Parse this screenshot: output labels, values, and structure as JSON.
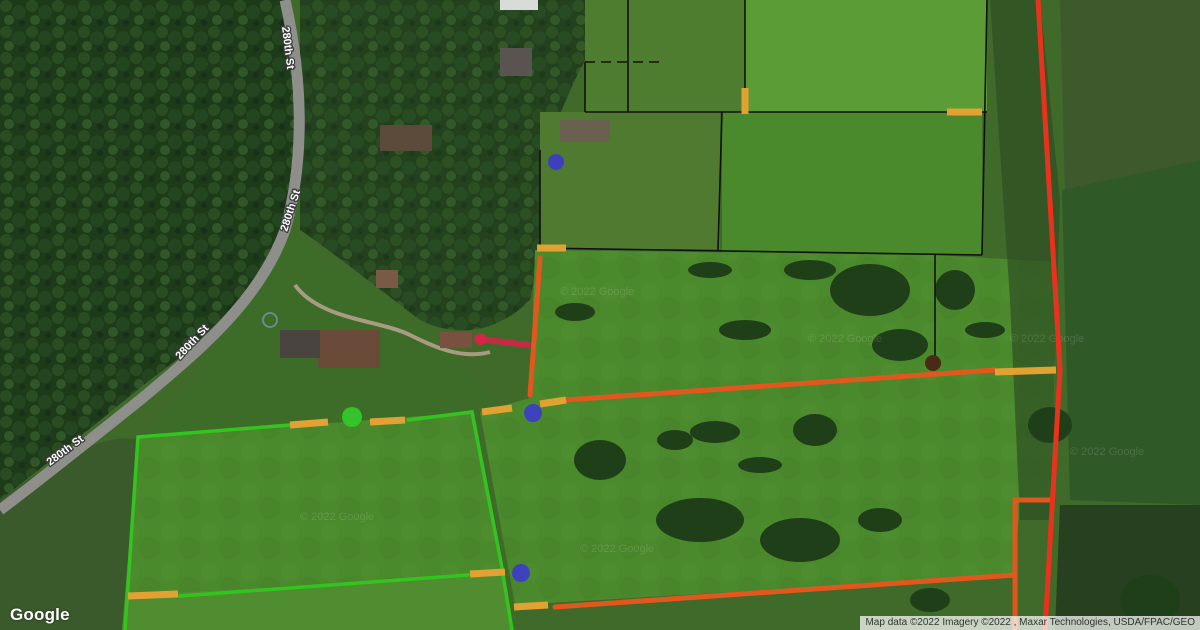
{
  "map": {
    "road_labels": [
      "280th St",
      "280th St",
      "280th St",
      "280th St"
    ],
    "watermark": "© 2022 Google",
    "logo": "Google",
    "attribution": "Map data ©2022 Imagery ©2022 , Maxar Technologies, USDA/FPAC/GEO"
  },
  "colors": {
    "fence_red": "#e8321e",
    "fence_orange": "#e2571e",
    "fence_green": "#33c420",
    "gate_tan": "#e2a233",
    "property_line": "#111111",
    "marker_blue": "#3b35d6",
    "marker_green": "#33c42a",
    "marker_brown": "#4a2a14",
    "arrow_pink": "#e0204a",
    "pasture": "#4c8a2c",
    "mown_field": "#5a9a34",
    "forest": "#1d3a19",
    "road": "#9a9a96"
  },
  "legend_semantics": {
    "lines": [
      "fence_red",
      "fence_orange",
      "fence_green",
      "gate_tan",
      "property_line"
    ],
    "markers": [
      "marker_blue",
      "marker_green",
      "marker_brown"
    ],
    "icons": [
      "arrow_pink"
    ]
  }
}
